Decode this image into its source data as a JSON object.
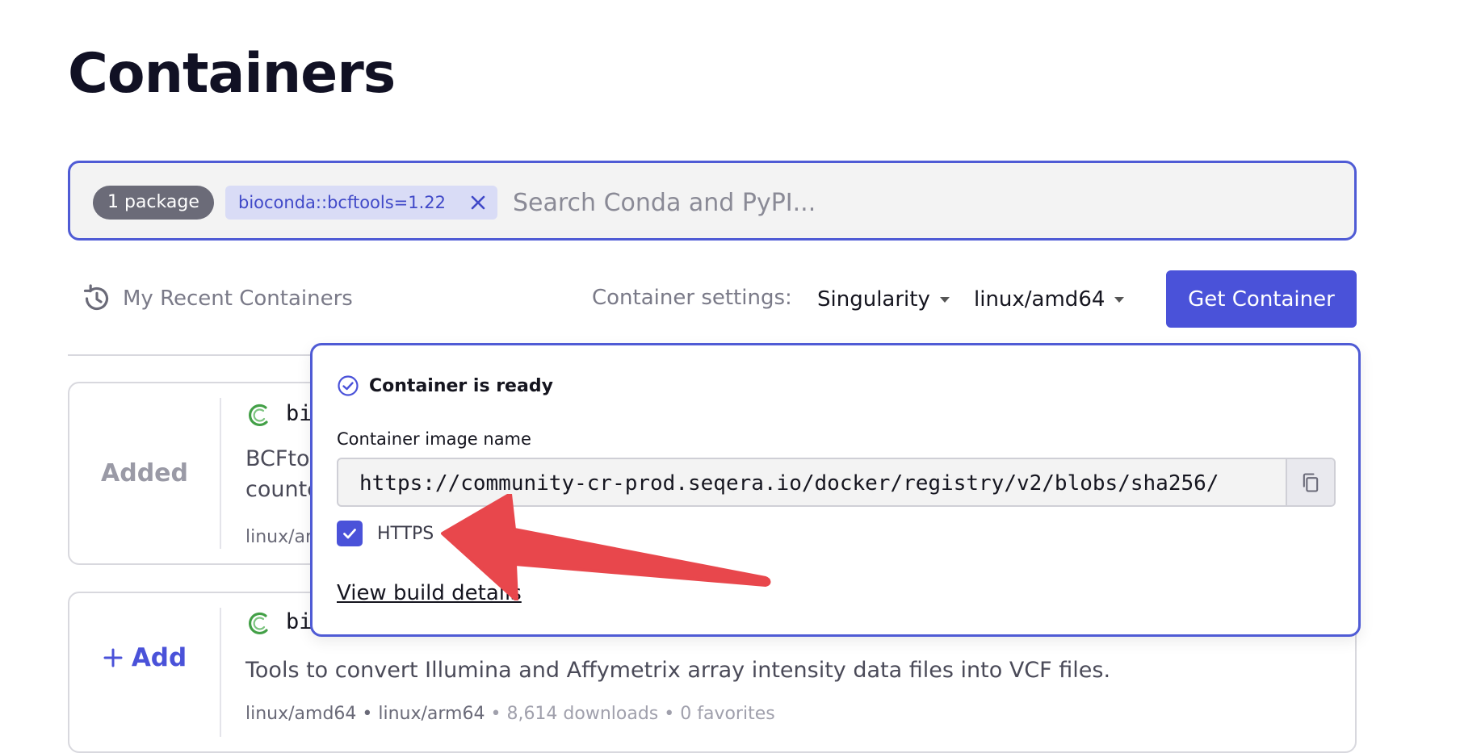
{
  "page": {
    "title": "Containers"
  },
  "search": {
    "package_count": "1 package",
    "selected_package": "bioconda::bcftools=1.22",
    "placeholder": "Search Conda and PyPI..."
  },
  "toolbar": {
    "recent_label": "My Recent Containers",
    "settings_label": "Container settings:",
    "runtime": "Singularity",
    "platform": "linux/amd64",
    "get_button": "Get Container"
  },
  "results": [
    {
      "status": "Added",
      "name": "bi",
      "description_line1": "BCFto",
      "description_line2": "counte",
      "meta": "linux/ar"
    },
    {
      "status": "Add",
      "name": "bi",
      "description": "Tools to convert Illumina and Affymetrix array intensity data files into VCF files.",
      "platforms": "linux/amd64 • linux/arm64",
      "stats": " • 8,614 downloads • 0 favorites"
    }
  ],
  "popover": {
    "status": "Container is ready",
    "field_label": "Container image name",
    "image_name": "https://community-cr-prod.seqera.io/docker/registry/v2/blobs/sha256/",
    "https_label": "HTTPS",
    "https_checked": true,
    "link": "View build details"
  },
  "colors": {
    "accent": "#4a52d9",
    "annotation": "#e8474c",
    "conda_icon": "#43a047"
  }
}
